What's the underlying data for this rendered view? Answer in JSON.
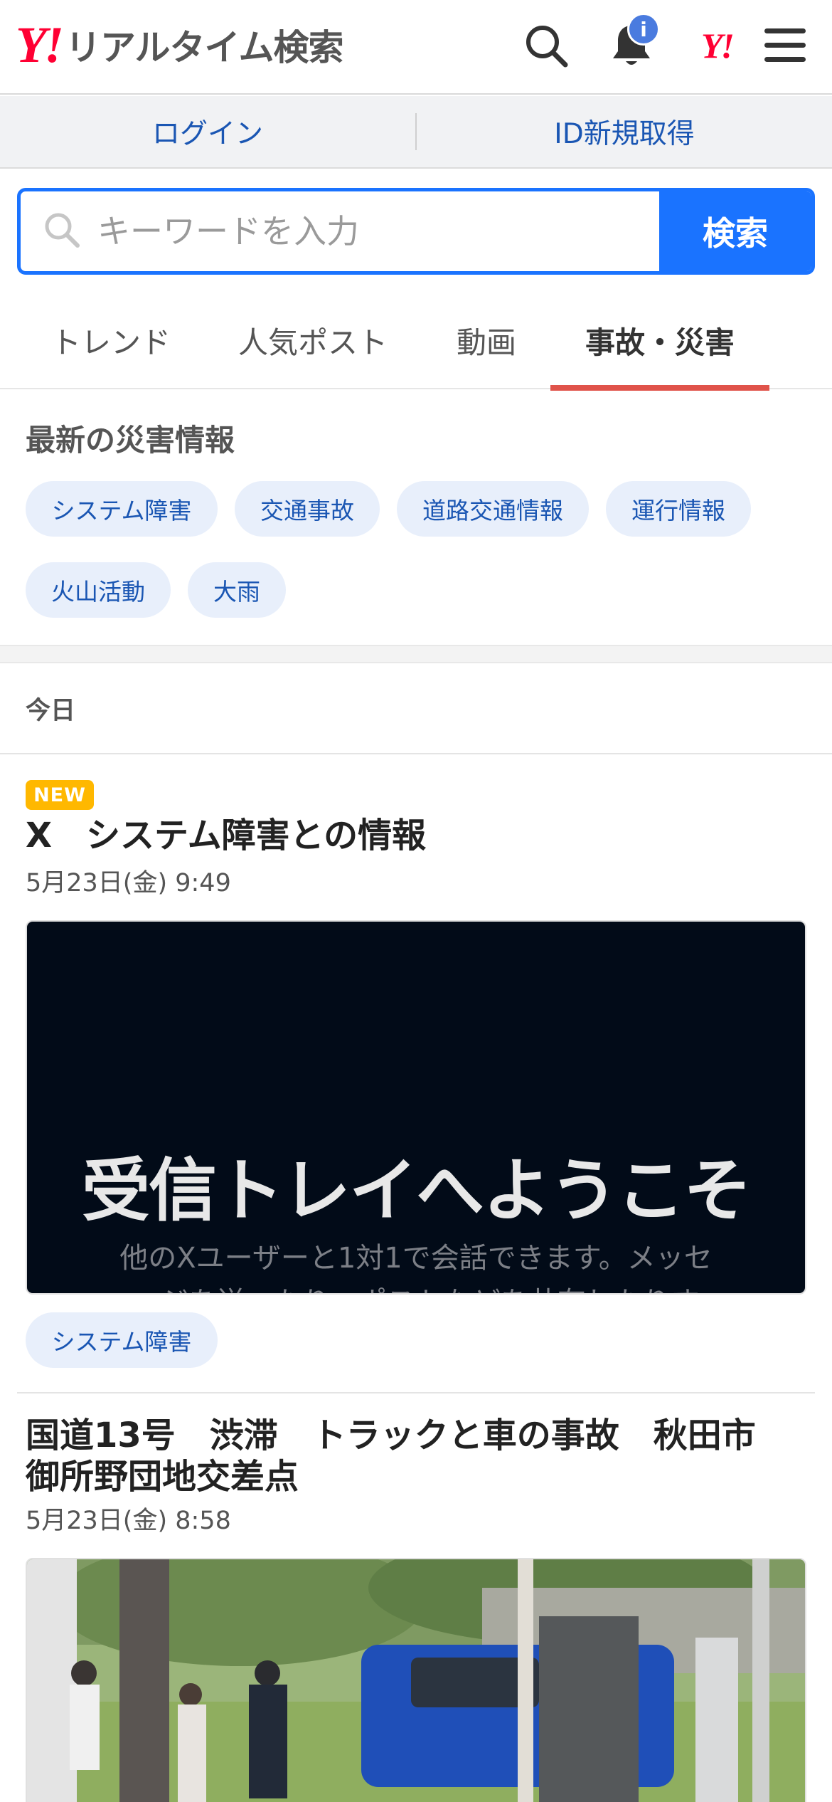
{
  "header": {
    "logo_mark": "Y!",
    "logo_text": "リアルタイム検索",
    "notification_badge": "i",
    "yahoo_mark": "Y!"
  },
  "account": {
    "login": "ログイン",
    "signup": "ID新規取得"
  },
  "search": {
    "placeholder": "キーワードを入力",
    "button": "検索"
  },
  "tabs": [
    {
      "label": "トレンド",
      "active": false
    },
    {
      "label": "人気ポスト",
      "active": false
    },
    {
      "label": "動画",
      "active": false
    },
    {
      "label": "事故・災害",
      "active": true
    }
  ],
  "disaster": {
    "title": "最新の災害情報",
    "chips": [
      "システム障害",
      "交通事故",
      "道路交通情報",
      "運行情報",
      "火山活動",
      "大雨"
    ]
  },
  "feed": {
    "section_label": "今日",
    "articles": [
      {
        "badge": "NEW",
        "title": "X　システム障害との情報",
        "date": "5月23日(金) 9:49",
        "image_headline": "受信トレイへようこそ",
        "image_subtext_1": "他のXユーザーと1対1で会話できます。メッセ",
        "image_subtext_2": "ージを送ったり、ポストなどを共有したりす",
        "tag": "システム障害"
      },
      {
        "title_line1": "国道13号　渋滞　トラックと車の事故　秋田市",
        "title_line2": "御所野団地交差点",
        "date": "5月23日(金) 8:58"
      }
    ]
  },
  "colors": {
    "brand_red": "#ff0033",
    "accent_blue": "#1a73ff",
    "link_blue": "#1a56b3",
    "tab_underline": "#e0534a",
    "new_badge": "#ffb800"
  }
}
